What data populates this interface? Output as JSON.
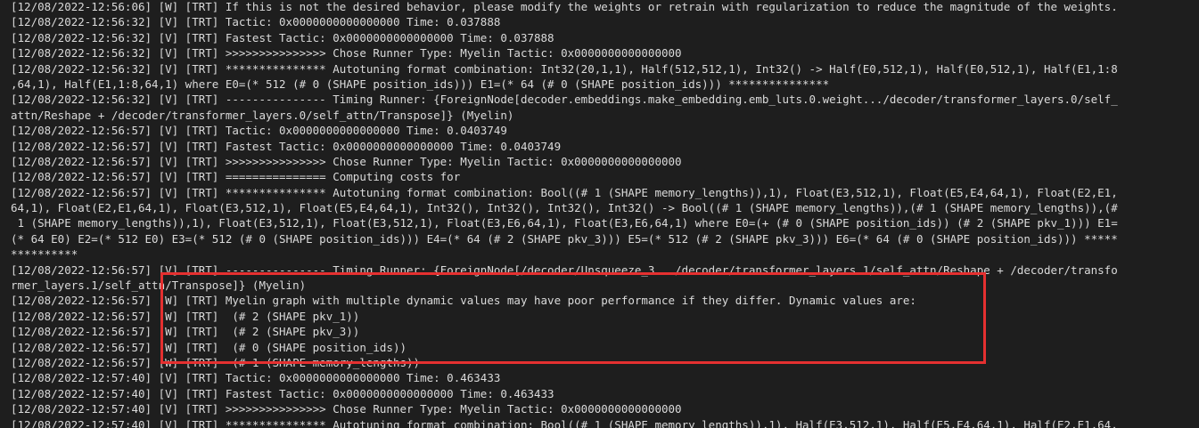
{
  "terminal": {
    "lines": [
      "[12/08/2022-12:56:06] [W] [TRT] If this is not the desired behavior, please modify the weights or retrain with regularization to reduce the magnitude of the weights.",
      "[12/08/2022-12:56:32] [V] [TRT] Tactic: 0x0000000000000000 Time: 0.037888",
      "[12/08/2022-12:56:32] [V] [TRT] Fastest Tactic: 0x0000000000000000 Time: 0.037888",
      "[12/08/2022-12:56:32] [V] [TRT] >>>>>>>>>>>>>>> Chose Runner Type: Myelin Tactic: 0x0000000000000000",
      "[12/08/2022-12:56:32] [V] [TRT] *************** Autotuning format combination: Int32(20,1,1), Half(512,512,1), Int32() -> Half(E0,512,1), Half(E0,512,1), Half(E1,1:8",
      ",64,1), Half(E1,1:8,64,1) where E0=(* 512 (# 0 (SHAPE position_ids))) E1=(* 64 (# 0 (SHAPE position_ids))) ***************",
      "[12/08/2022-12:56:32] [V] [TRT] --------------- Timing Runner: {ForeignNode[decoder.embeddings.make_embedding.emb_luts.0.weight.../decoder/transformer_layers.0/self_",
      "attn/Reshape + /decoder/transformer_layers.0/self_attn/Transpose]} (Myelin)",
      "[12/08/2022-12:56:57] [V] [TRT] Tactic: 0x0000000000000000 Time: 0.0403749",
      "[12/08/2022-12:56:57] [V] [TRT] Fastest Tactic: 0x0000000000000000 Time: 0.0403749",
      "[12/08/2022-12:56:57] [V] [TRT] >>>>>>>>>>>>>>> Chose Runner Type: Myelin Tactic: 0x0000000000000000",
      "[12/08/2022-12:56:57] [V] [TRT] =============== Computing costs for",
      "[12/08/2022-12:56:57] [V] [TRT] *************** Autotuning format combination: Bool((# 1 (SHAPE memory_lengths)),1), Float(E3,512,1), Float(E5,E4,64,1), Float(E2,E1,",
      "64,1), Float(E2,E1,64,1), Float(E3,512,1), Float(E5,E4,64,1), Int32(), Int32(), Int32(), Int32() -> Bool((# 1 (SHAPE memory_lengths)),(# 1 (SHAPE memory_lengths)),(#",
      " 1 (SHAPE memory_lengths)),1), Float(E3,512,1), Float(E3,512,1), Float(E3,E6,64,1), Float(E3,E6,64,1) where E0=(+ (# 0 (SHAPE position_ids)) (# 2 (SHAPE pkv_1))) E1=",
      "(* 64 E0) E2=(* 512 E0) E3=(* 512 (# 0 (SHAPE position_ids))) E4=(* 64 (# 2 (SHAPE pkv_3))) E5=(* 512 (# 2 (SHAPE pkv_3))) E6=(* 64 (# 0 (SHAPE position_ids))) *****",
      "**********",
      "[12/08/2022-12:56:57] [V] [TRT] --------------- Timing Runner: {ForeignNode[/decoder/Unsqueeze_3.../decoder/transformer_layers.1/self_attn/Reshape + /decoder/transfo",
      "rmer_layers.1/self_attn/Transpose]} (Myelin)",
      "[12/08/2022-12:56:57] [W] [TRT] Myelin graph with multiple dynamic values may have poor performance if they differ. Dynamic values are:",
      "[12/08/2022-12:56:57] [W] [TRT]  (# 2 (SHAPE pkv_1))",
      "[12/08/2022-12:56:57] [W] [TRT]  (# 2 (SHAPE pkv_3))",
      "[12/08/2022-12:56:57] [W] [TRT]  (# 0 (SHAPE position_ids))",
      "[12/08/2022-12:56:57] [W] [TRT]  (# 1 (SHAPE memory_lengths))",
      "[12/08/2022-12:57:40] [V] [TRT] Tactic: 0x0000000000000000 Time: 0.463433",
      "[12/08/2022-12:57:40] [V] [TRT] Fastest Tactic: 0x0000000000000000 Time: 0.463433",
      "[12/08/2022-12:57:40] [V] [TRT] >>>>>>>>>>>>>>> Chose Runner Type: Myelin Tactic: 0x0000000000000000",
      "[12/08/2022-12:57:40] [V] [TRT] *************** Autotuning format combination: Bool((# 1 (SHAPE memory_lengths)),1), Half(E3,512,1), Half(E5,E4,64,1), Half(E2,E1,64,"
    ]
  },
  "colors": {
    "background": "#1e1e1e",
    "text": "#dadada",
    "highlight_border": "#e53030"
  }
}
